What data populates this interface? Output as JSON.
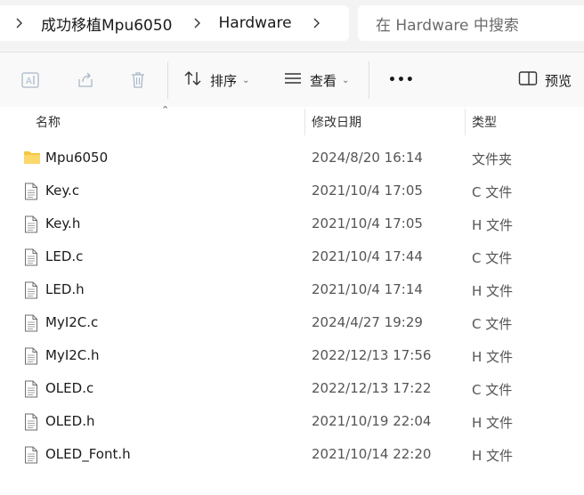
{
  "breadcrumb": {
    "items": [
      "成功移植Mpu6050",
      "Hardware"
    ]
  },
  "search": {
    "placeholder": "在 Hardware 中搜索"
  },
  "toolbar": {
    "sort_label": "排序",
    "view_label": "查看",
    "more_label": "•••",
    "preview_label": "预览",
    "icons": [
      "rename-icon",
      "share-icon",
      "delete-icon",
      "sort-icon",
      "view-icon",
      "preview-icon"
    ]
  },
  "columns": {
    "name": "名称",
    "date": "修改日期",
    "type": "类型"
  },
  "files": [
    {
      "name": "Mpu6050",
      "date": "2024/8/20 16:14",
      "type": "文件夹",
      "kind": "folder"
    },
    {
      "name": "Key.c",
      "date": "2021/10/4 17:05",
      "type": "C 文件",
      "kind": "file"
    },
    {
      "name": "Key.h",
      "date": "2021/10/4 17:05",
      "type": "H 文件",
      "kind": "file"
    },
    {
      "name": "LED.c",
      "date": "2021/10/4 17:44",
      "type": "C 文件",
      "kind": "file"
    },
    {
      "name": "LED.h",
      "date": "2021/10/4 17:14",
      "type": "H 文件",
      "kind": "file"
    },
    {
      "name": "MyI2C.c",
      "date": "2024/4/27 19:29",
      "type": "C 文件",
      "kind": "file"
    },
    {
      "name": "MyI2C.h",
      "date": "2022/12/13 17:56",
      "type": "H 文件",
      "kind": "file"
    },
    {
      "name": "OLED.c",
      "date": "2022/12/13 17:22",
      "type": "C 文件",
      "kind": "file"
    },
    {
      "name": "OLED.h",
      "date": "2021/10/19 22:04",
      "type": "H 文件",
      "kind": "file"
    },
    {
      "name": "OLED_Font.h",
      "date": "2021/10/14 22:20",
      "type": "H 文件",
      "kind": "file"
    }
  ],
  "colors": {
    "folder": "#f5c542",
    "accent": "#0067c0"
  }
}
